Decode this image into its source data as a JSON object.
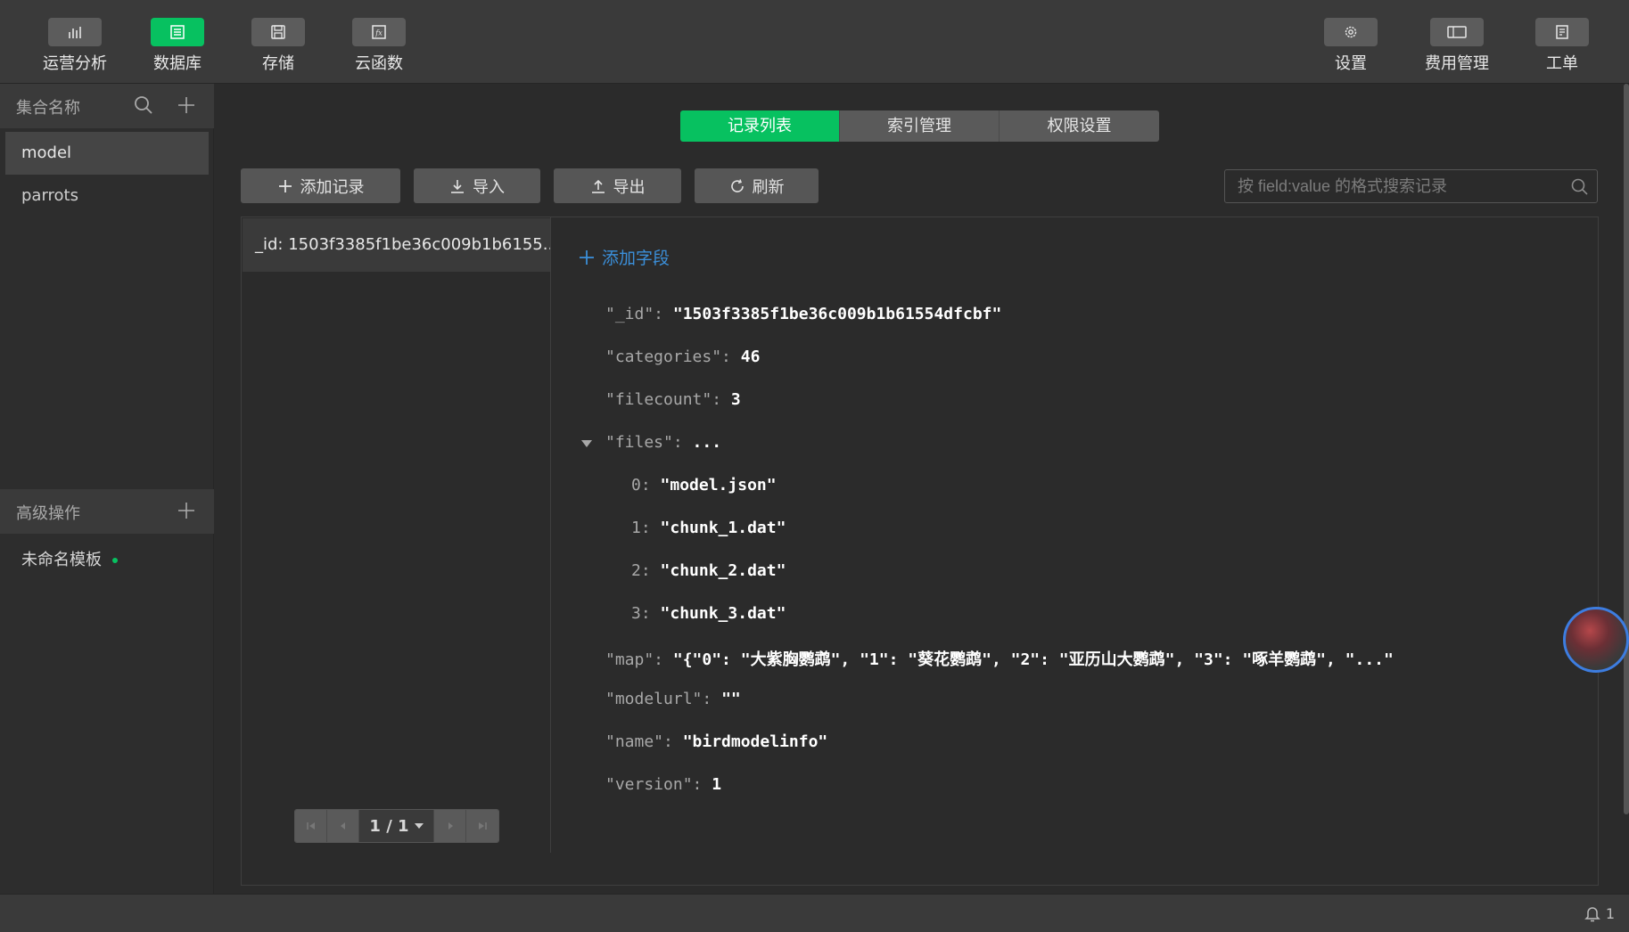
{
  "toolbar": {
    "left": [
      {
        "label": "运营分析",
        "icon": "bar-chart-icon"
      },
      {
        "label": "数据库",
        "icon": "database-icon",
        "active": true
      },
      {
        "label": "存储",
        "icon": "floppy-disk-icon"
      },
      {
        "label": "云函数",
        "icon": "function-icon"
      }
    ],
    "right": [
      {
        "label": "设置",
        "icon": "gear-icon"
      },
      {
        "label": "费用管理",
        "icon": "billing-icon"
      },
      {
        "label": "工单",
        "icon": "ticket-icon"
      }
    ]
  },
  "sidebar": {
    "collections_title": "集合名称",
    "collections": [
      {
        "name": "model",
        "selected": true
      },
      {
        "name": "parrots",
        "selected": false
      }
    ],
    "advanced_title": "高级操作",
    "template": "未命名模板"
  },
  "tabs": [
    {
      "label": "记录列表",
      "active": true
    },
    {
      "label": "索引管理",
      "active": false
    },
    {
      "label": "权限设置",
      "active": false
    }
  ],
  "actions": {
    "add": "添加记录",
    "import": "导入",
    "export": "导出",
    "refresh": "刷新"
  },
  "search": {
    "placeholder": "按 field:value 的格式搜索记录"
  },
  "records": [
    {
      "label": "_id: 1503f3385f1be36c009b1b6155..."
    }
  ],
  "pager": {
    "text": "1 / 1"
  },
  "detail": {
    "add_field": "添加字段",
    "id": {
      "key": "\"_id\":",
      "value": "\"1503f3385f1be36c009b1b61554dfcbf\""
    },
    "categories": {
      "key": "\"categories\":",
      "value": "46"
    },
    "filecount": {
      "key": "\"filecount\":",
      "value": "3"
    },
    "files": {
      "key": "\"files\":",
      "value": "...",
      "items": [
        {
          "index": "0:",
          "value": "\"model.json\""
        },
        {
          "index": "1:",
          "value": "\"chunk_1.dat\""
        },
        {
          "index": "2:",
          "value": "\"chunk_2.dat\""
        },
        {
          "index": "3:",
          "value": "\"chunk_3.dat\""
        }
      ]
    },
    "map": {
      "key": "\"map\":",
      "value": "\"{\"0\": \"大紫胸鹦鹉\", \"1\": \"葵花鹦鹉\", \"2\": \"亚历山大鹦鹉\", \"3\": \"啄羊鹦鹉\", \"...\""
    },
    "modelurl": {
      "key": "\"modelurl\":",
      "value": "\"\""
    },
    "name": {
      "key": "\"name\":",
      "value": "\"birdmodelinfo\""
    },
    "version": {
      "key": "\"version\":",
      "value": "1"
    }
  },
  "status": {
    "notifications": "1"
  },
  "colors": {
    "accent": "#07c160",
    "link": "#3b8fd9",
    "background": "#2b2b2b",
    "toolbar": "#3a3a3a"
  }
}
